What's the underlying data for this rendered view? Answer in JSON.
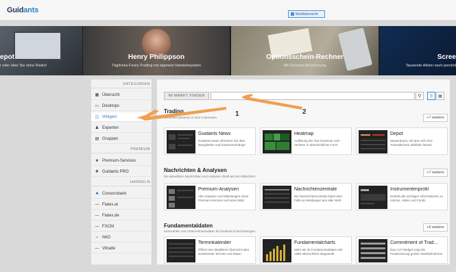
{
  "app": {
    "logo_main": "Guid",
    "logo_accent": "ants",
    "top_button": "Marktübersicht"
  },
  "carousel": [
    {
      "title": "epot",
      "subtitle": "r oder über Sie ohne Risiko!"
    },
    {
      "title": "Henry Philippson",
      "subtitle": "Tägliches Forex-Trading mit eigenem Handelssystem"
    },
    {
      "title": "Optionsschein-Rechner",
      "subtitle": "Mit Szenario-Berechnung"
    },
    {
      "title": "Scree",
      "subtitle": "Tausende Aktien nach persönl"
    }
  ],
  "sidebar": {
    "sections": [
      {
        "header": "KATEGORIEN",
        "items": [
          {
            "label": "Übersicht",
            "icon": "grid-icon"
          },
          {
            "label": "Desktops",
            "icon": "monitor-icon"
          },
          {
            "label": "Widgets",
            "icon": "calendar-icon",
            "active": true
          },
          {
            "label": "Experten",
            "icon": "person-icon"
          },
          {
            "label": "Gruppen",
            "icon": "group-icon"
          }
        ]
      },
      {
        "header": "PREMIUM",
        "items": [
          {
            "label": "Premium-Services",
            "icon": "star-icon"
          },
          {
            "label": "Guidants PRO",
            "icon": "pro-icon"
          }
        ]
      },
      {
        "header": "HANDELN",
        "items": [
          {
            "label": "Consorsbank",
            "icon": "bank-icon"
          },
          {
            "label": "Flatex.at",
            "icon": "broker-icon"
          },
          {
            "label": "Flatex.de",
            "icon": "broker-icon"
          },
          {
            "label": "FXCM",
            "icon": "broker-icon"
          },
          {
            "label": "IWO",
            "icon": "broker-icon"
          },
          {
            "label": "Vitrade",
            "icon": "broker-icon"
          }
        ]
      }
    ]
  },
  "search": {
    "label": "IM MARKT FINDEN",
    "placeholder": "",
    "value": ""
  },
  "categories": [
    {
      "title": "Trading",
      "subtitle": "Elemente passend zu Ihren Interessen",
      "more": "+7 weitere",
      "cards": [
        {
          "title": "Guidants News",
          "desc": "Guidants News informiert Sie über Neuigkeiten und Zusammenhänge"
        },
        {
          "title": "Heatmap",
          "desc": "Auflistung der Top-Gewinner und -Verlierer in übersichtlicher Form"
        },
        {
          "title": "Depot",
          "desc": "Musterdepot, mit dem sich Ihre Transaktionen abbilden lassen"
        }
      ]
    },
    {
      "title": "Nachrichten & Analysen",
      "subtitle": "Die aktuellsten Nachrichten und Analysen direkt auf den Bildschirm",
      "more": "+7 weitere",
      "cards": [
        {
          "title": "Premium-Analysen",
          "desc": "Alle Analysen und Mitteilungen eines Premium-Services auf einen Blick"
        },
        {
          "title": "Nachrichtenzentrale",
          "desc": "Die Nachrichtenzentrale bietet eine Fülle an Meldungen aus aller Welt"
        },
        {
          "title": "Instrumentenprofil",
          "desc": "Enthält alle wichtigen Informationen zu Indizes, Aktien und Fonds"
        }
      ]
    },
    {
      "title": "Fundamentaldaten",
      "subtitle": "Kennzahlen und Unternehmensdaten für fundierte Entscheidungen",
      "more": "+6 weitere",
      "cards": [
        {
          "title": "Terminkalender",
          "desc": "Öffnet eine detaillierte Übersicht über anstehende Termine und Daten"
        },
        {
          "title": "Fundamentalcharts",
          "desc": "Mehr als 30 Fundamentaldaten seit 1995 übersichtlich dargestellt"
        },
        {
          "title": "Commitment of Trad...",
          "desc": "Das CoT-Widget zeigt die Positionierung großer Marktteilnehmer"
        }
      ]
    }
  ],
  "annotations": {
    "one": "1",
    "two": "2",
    "color": "#f0a050"
  }
}
